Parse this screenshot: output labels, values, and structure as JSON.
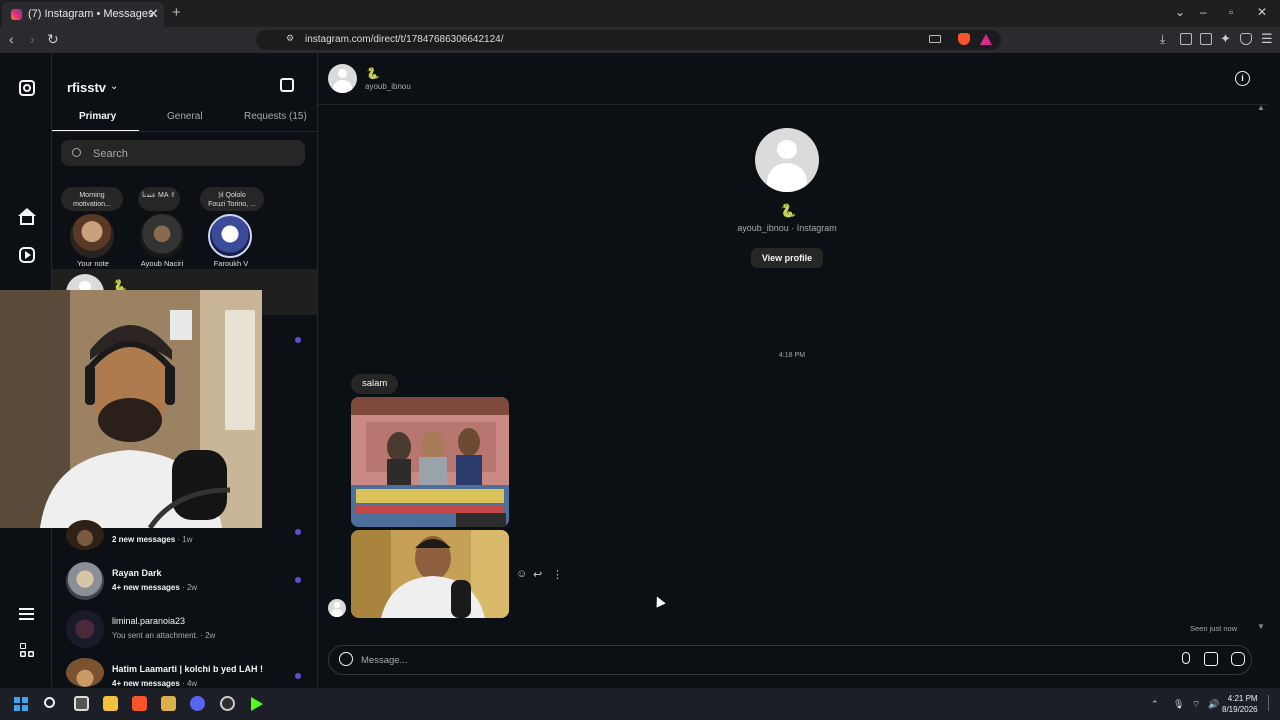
{
  "browser": {
    "tab_title": "(7) Instagram • Messages",
    "tab_close": "✕",
    "new_tab": "+",
    "url": "instagram.com/direct/t/17847686306642124/"
  },
  "sidebar": {
    "username": "rfisstv",
    "tabs": [
      {
        "label": "Primary"
      },
      {
        "label": "General"
      },
      {
        "label": "Requests (15)"
      }
    ],
    "search_placeholder": "Search",
    "notes": [
      {
        "text": "Morning motivation..."
      },
      {
        "text": "عندنا MA ✌"
      },
      {
        "text": "|ıl Qololo\nFouzi Torino, ..."
      }
    ],
    "stories": [
      {
        "name": "Your note"
      },
      {
        "name": "Ayoub Naciri"
      },
      {
        "name": "Faroukh V"
      }
    ],
    "conversations": [
      {
        "name": "",
        "sub_bold": "2 new messages",
        "sub_time": " · 1w"
      },
      {
        "name": "Rayan Dark",
        "sub_bold": "4+ new messages",
        "sub_time": " · 2w"
      },
      {
        "name": "liminal.paranoia23",
        "sub_plain": "You sent an attachment. · 2w"
      },
      {
        "name": "Hatim Laamarti | kolchi b yed LAH !",
        "sub_bold": "4+ new messages",
        "sub_time": " · 4w"
      }
    ]
  },
  "chat": {
    "header_handle": "ayoub_ibnou",
    "profile_subtitle": "ayoub_ibnou · Instagram",
    "view_profile": "View profile",
    "timestamp": "4:18 PM",
    "message_text": "salam",
    "seen": "Seen just now",
    "composer_placeholder": "Message..."
  },
  "taskbar": {
    "time": "4:21 PM",
    "date": "8/19/2026"
  },
  "colors": {
    "background": "#0c1014",
    "accent_dot": "#5851db",
    "bubble": "#262626"
  }
}
